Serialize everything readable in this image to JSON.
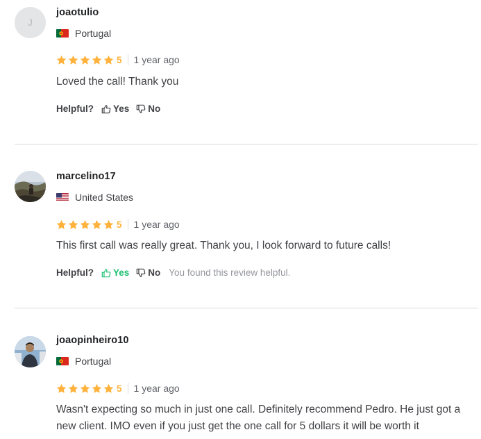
{
  "reviews": [
    {
      "avatar_initial": "J",
      "username": "joaotulio",
      "country": "Portugal",
      "flag_icon": "portugal-flag-icon",
      "rating": "5",
      "age": "1 year ago",
      "text": "Loved the call! Thank you",
      "helpful_label": "Helpful?",
      "yes_label": "Yes",
      "no_label": "No",
      "helpful_message": ""
    },
    {
      "avatar_initial": "",
      "username": "marcelino17",
      "country": "United States",
      "flag_icon": "usa-flag-icon",
      "rating": "5",
      "age": "1 year ago",
      "text": "This first call was really great. Thank you, I look forward to future calls!",
      "helpful_label": "Helpful?",
      "yes_label": "Yes",
      "no_label": "No",
      "helpful_message": "You found this review helpful."
    },
    {
      "avatar_initial": "",
      "username": "joaopinheiro10",
      "country": "Portugal",
      "flag_icon": "portugal-flag-icon",
      "rating": "5",
      "age": "1 year ago",
      "text": "Wasn't expecting so much in just one call. Definitely recommend Pedro. He just got a new client. IMO even if you just get the one call for 5 dollars it will be worth it",
      "helpful_label": "",
      "yes_label": "",
      "no_label": "",
      "helpful_message": ""
    }
  ],
  "colors": {
    "star": "#ffb33e",
    "helpful_active": "#1dbf73",
    "divider": "#dadbdd"
  }
}
